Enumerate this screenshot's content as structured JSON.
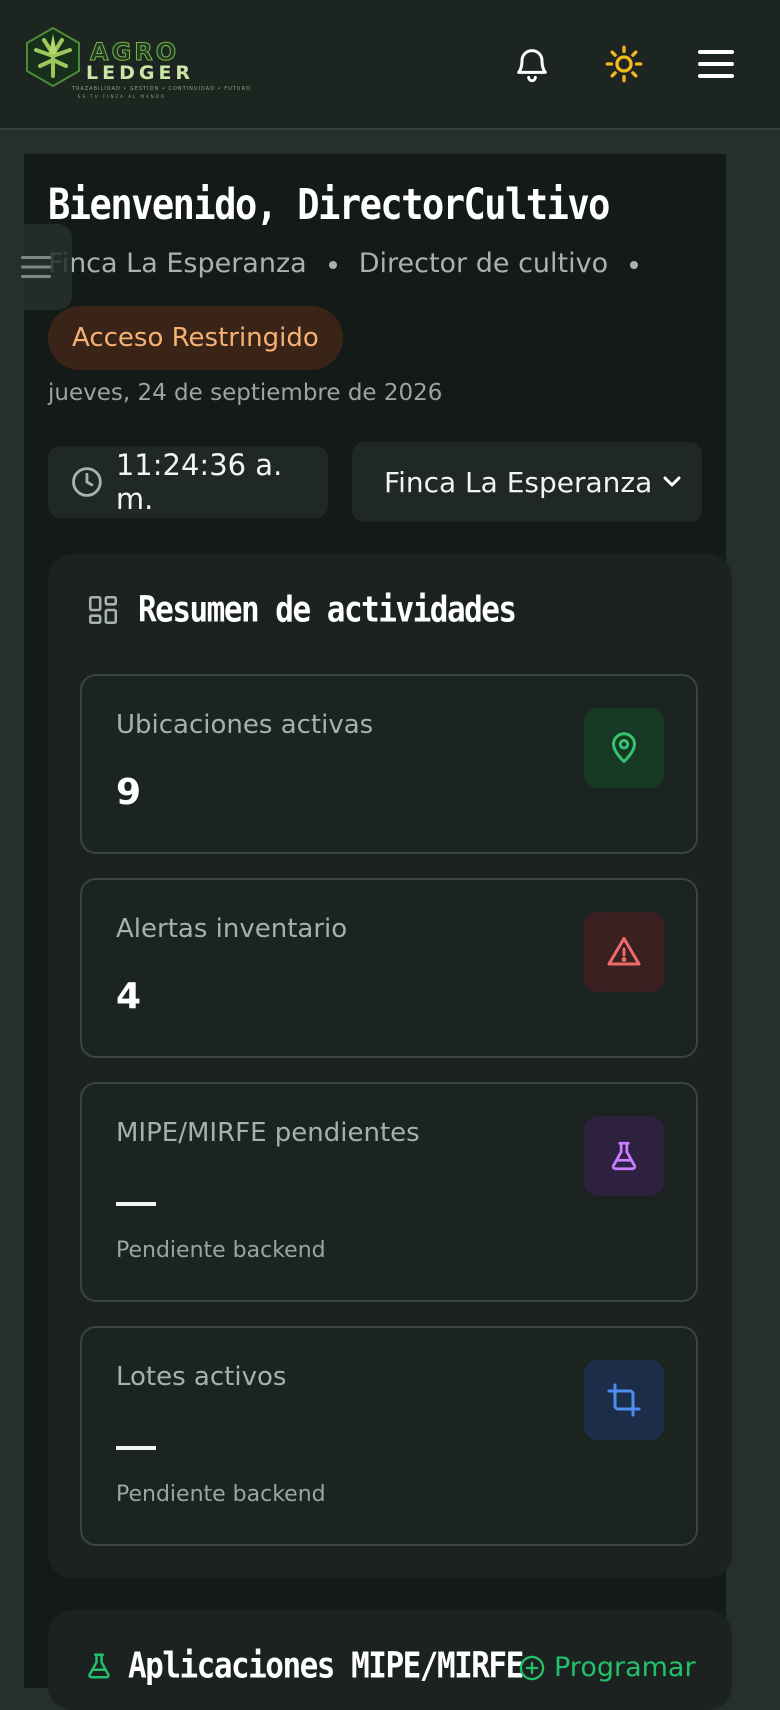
{
  "header": {
    "logo": {
      "line1": "AGRO",
      "line2": "LEDGER",
      "tagline": "TRAZABILIDAD • GESTIÓN • CONTINUIDAD • FUTURO",
      "subline": "ES TU FINCA AL MANDO"
    },
    "icons": [
      "bell-icon",
      "sun-icon",
      "menu-icon"
    ],
    "sun_color": "#f4b81c"
  },
  "welcome": {
    "title": "Bienvenido, DirectorCultivo",
    "finca": "Finca La Esperanza",
    "role": "Director de cultivo",
    "badge": "Acceso Restringido",
    "date": "jueves, 24 de septiembre de 2026",
    "time": "11:24:36 a. m.",
    "selected_finca": "Finca La Esperanza"
  },
  "summary": {
    "title": "Resumen de actividades",
    "cards": [
      {
        "label": "Ubicaciones activas",
        "value": "9",
        "icon": "map-pin-icon",
        "accent": "#35c46e"
      },
      {
        "label": "Alertas inventario",
        "value": "4",
        "icon": "alert-triangle-icon",
        "accent": "#ef6b6b"
      },
      {
        "label": "MIPE/MIRFE pendientes",
        "note": "Pendiente backend",
        "icon": "flask-icon",
        "accent": "#c77dff"
      },
      {
        "label": "Lotes activos",
        "note": "Pendiente backend",
        "icon": "crop-icon",
        "accent": "#4d8ff0"
      }
    ]
  },
  "applications": {
    "title": "Aplicaciones MIPE/MIRFE",
    "action": "Programar"
  }
}
